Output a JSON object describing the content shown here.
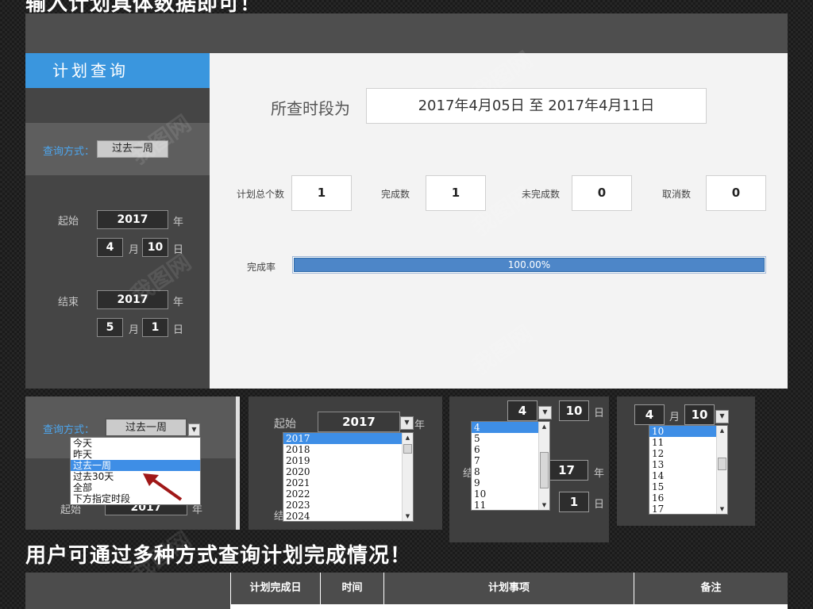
{
  "top_caption": "输入计划具体数据即可！",
  "sidebar": {
    "title": "计划查询",
    "query_mode_label": "查询方式：",
    "query_mode_value": "过去一周",
    "start_label": "起始",
    "start_year": "2017",
    "start_month": "4",
    "start_day": "10",
    "end_label": "结束",
    "end_year": "2017",
    "end_month": "5",
    "end_day": "1",
    "year_unit": "年",
    "month_unit": "月",
    "day_unit": "日"
  },
  "main": {
    "period_label": "所查时段为",
    "period_value": "2017年4月05日 至 2017年4月11日",
    "stats": [
      {
        "label": "计划总个数",
        "value": "1"
      },
      {
        "label": "完成数",
        "value": "1"
      },
      {
        "label": "未完成数",
        "value": "0"
      },
      {
        "label": "取消数",
        "value": "0"
      }
    ],
    "completion_label": "完成率",
    "completion_text": "100.00%",
    "completion_fraction": 1.0
  },
  "thumb1": {
    "query_mode_label": "查询方式：",
    "query_mode_value": "过去一周",
    "options": [
      "今天",
      "昨天",
      "过去一周",
      "过去30天",
      "全部",
      "下方指定时段"
    ],
    "selected_index": 2,
    "start_label": "起始",
    "start_year": "2017",
    "year_unit": "年"
  },
  "thumb2": {
    "start_label": "起始",
    "year_value": "2017",
    "year_unit": "年",
    "options": [
      "2017",
      "2018",
      "2019",
      "2020",
      "2021",
      "2022",
      "2023",
      "2024"
    ],
    "selected_index": 0,
    "end_label_partial": "结"
  },
  "thumb3": {
    "month_value": "4",
    "day_value": "10",
    "day_unit": "日",
    "year_unit": "年",
    "year_partial": "17",
    "end_day_value": "1",
    "end_label_partial": "结",
    "options": [
      "4",
      "5",
      "6",
      "7",
      "8",
      "9",
      "10",
      "11"
    ],
    "selected_index": 0
  },
  "thumb4": {
    "month_value": "4",
    "month_unit": "月",
    "day_value": "10",
    "options": [
      "10",
      "11",
      "12",
      "13",
      "14",
      "15",
      "16",
      "17"
    ],
    "selected_index": 0
  },
  "bottom_caption": "用户可通过多种方式查询计划完成情况！",
  "table": {
    "headers": [
      "计划完成日",
      "时间",
      "计划事项",
      "备注"
    ]
  },
  "colors": {
    "accent_blue": "#3a96de",
    "progress_fill": "#4d86c8",
    "panel_dark": "#454545",
    "content_bg": "#f3f3f3"
  }
}
